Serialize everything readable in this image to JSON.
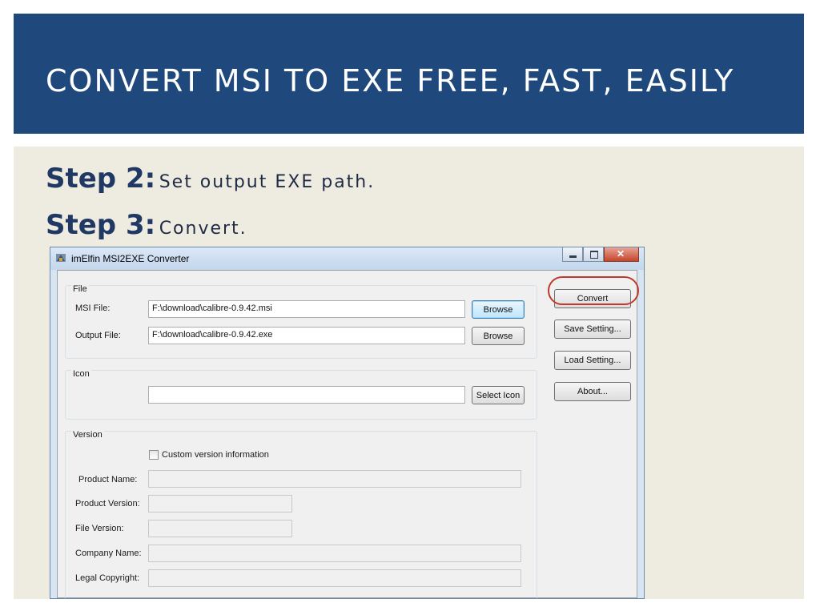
{
  "slide": {
    "title": "CONVERT MSI TO EXE FREE, FAST, EASILY",
    "steps": [
      {
        "label": "Step 2:",
        "text": "Set output EXE path."
      },
      {
        "label": "Step 3:",
        "text": "Convert."
      }
    ]
  },
  "window": {
    "title": "imElfin MSI2EXE Converter",
    "file_group": {
      "label": "File",
      "msi_label": "MSI File:",
      "msi_value": "F:\\download\\calibre-0.9.42.msi",
      "output_label": "Output File:",
      "output_value": "F:\\download\\calibre-0.9.42.exe",
      "browse_label": "Browse"
    },
    "icon_group": {
      "label": "Icon",
      "icon_value": "",
      "select_label": "Select Icon"
    },
    "version_group": {
      "label": "Version",
      "custom_label": "Custom version information",
      "custom_checked": false,
      "product_name_label": "Product Name:",
      "product_version_label": "Product Version:",
      "file_version_label": "File Version:",
      "company_name_label": "Company Name:",
      "legal_copyright_label": "Legal Copyright:"
    },
    "buttons": {
      "convert": "Convert",
      "save": "Save Setting...",
      "load": "Load Setting...",
      "about": "About..."
    }
  },
  "colors": {
    "header_bg": "#1f497d",
    "content_bg": "#eeece1",
    "highlight": "#c0392b"
  }
}
